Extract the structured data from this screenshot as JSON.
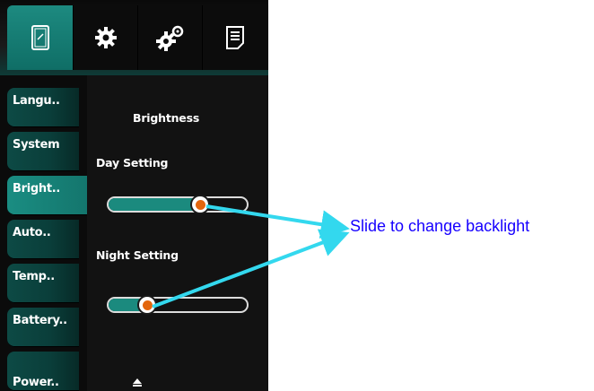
{
  "toolbar": {
    "tabs": [
      {
        "icon": "phone-icon",
        "active": true
      },
      {
        "icon": "gear-icon",
        "active": false
      },
      {
        "icon": "gears-icon",
        "active": false
      },
      {
        "icon": "document-icon",
        "active": false
      }
    ]
  },
  "sidebar": {
    "items": [
      {
        "label": "Langu..",
        "active": false
      },
      {
        "label": "System",
        "active": false
      },
      {
        "label": "Bright..",
        "active": true
      },
      {
        "label": "Auto..",
        "active": false
      },
      {
        "label": "Temp..",
        "active": false
      },
      {
        "label": "Battery..",
        "active": false
      },
      {
        "label": "Power..",
        "active": false
      }
    ]
  },
  "panel": {
    "title": "Brightness",
    "day": {
      "label": "Day Setting",
      "value_fraction": 0.66
    },
    "night": {
      "label": "Night Setting",
      "value_fraction": 0.28
    },
    "scroll_icon": "up-arrow-icon"
  },
  "annotation": {
    "text": "Slide to change backlight",
    "arrow_color": "#33d8ee",
    "text_color": "#1600ff"
  },
  "colors": {
    "accent": "#1b8a7e",
    "knob_center": "#e3660d",
    "background": "#121212"
  }
}
